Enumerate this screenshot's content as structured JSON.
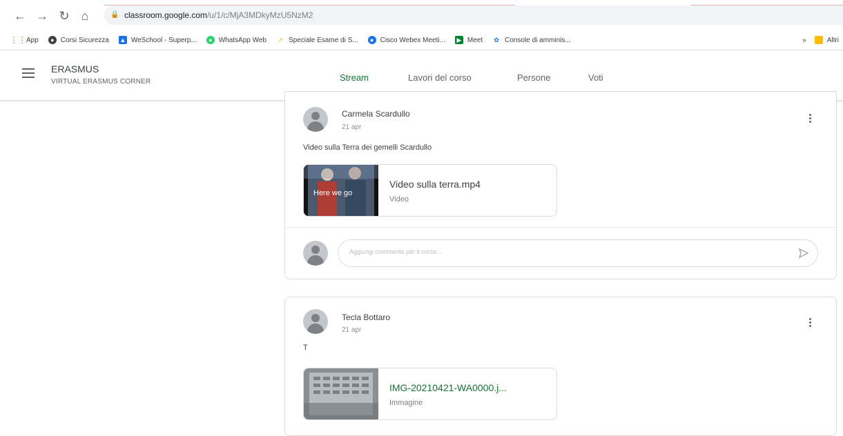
{
  "browser": {
    "url_host": "classroom.google.com",
    "url_path": "/u/1/c/MjA3MDkyMzU5NzM2",
    "bookmarks": [
      {
        "label": "App",
        "icon": "apps-grid-icon",
        "color": "#e8710a"
      },
      {
        "label": "Corsi Sicurezza",
        "icon": "globe-icon",
        "color": "#3c4043"
      },
      {
        "label": "WeSchool - Superp...",
        "icon": "weschool-icon",
        "color": "#1a73e8"
      },
      {
        "label": "WhatsApp Web",
        "icon": "whatsapp-icon",
        "color": "#25d366"
      },
      {
        "label": "Speciale Esame di S...",
        "icon": "zanichelli-icon",
        "color": "#f9ab00"
      },
      {
        "label": "Cisco Webex Meeti...",
        "icon": "webex-icon",
        "color": "#1a73e8"
      },
      {
        "label": "Meet",
        "icon": "meet-icon",
        "color": "#00832d"
      },
      {
        "label": "Console di amminis...",
        "icon": "admin-icon",
        "color": "#1a73e8"
      }
    ],
    "more": "»",
    "other_bookmarks": "Altri"
  },
  "header": {
    "class_name": "ERASMUS",
    "class_section": "VIRTUAL ERASMUS CORNER",
    "tabs": [
      "Stream",
      "Lavori del corso",
      "Persone",
      "Voti"
    ],
    "active_tab": "Stream",
    "accent": "#137333"
  },
  "posts": [
    {
      "author": "Carmela Scardullo",
      "date": "21 apr",
      "text": "Video sulla Terra dei gemelli Scardullo",
      "attachment": {
        "title": "Video sulla terra.mp4",
        "type": "Video",
        "thumb_caption": "Here we go"
      },
      "comment_placeholder": "Aggiungi commento per il corso..."
    },
    {
      "author": "Tecla Bottaro",
      "date": "21 apr",
      "text": "T",
      "attachment": {
        "title": "IMG-20210421-WA0000.j...",
        "type": "Immagine"
      }
    }
  ]
}
